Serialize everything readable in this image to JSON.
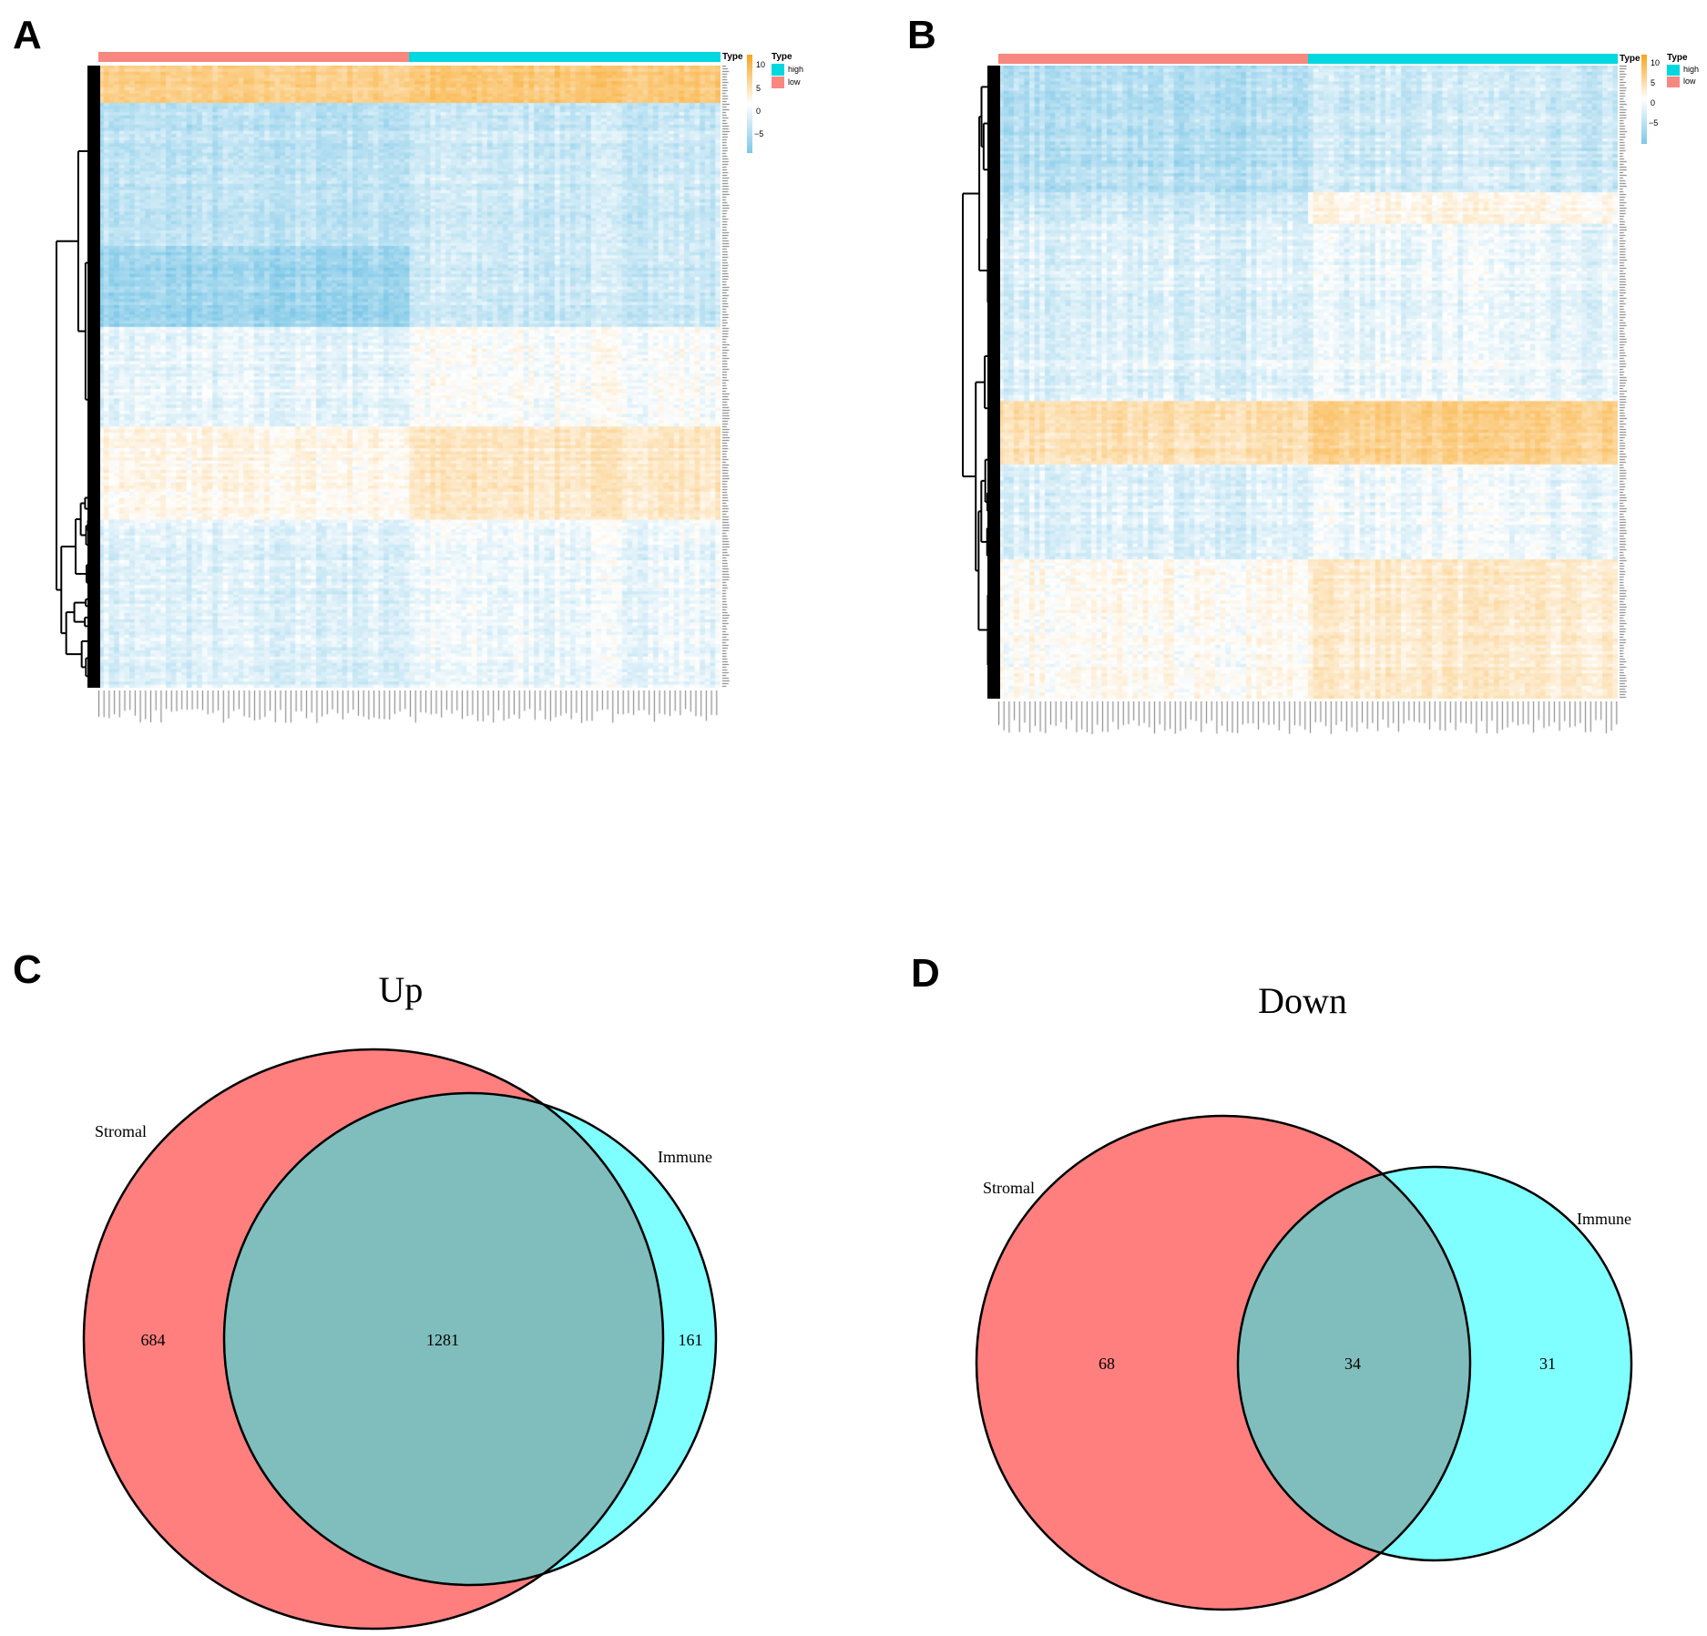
{
  "panels": {
    "a": "A",
    "b": "B",
    "c": "C",
    "d": "D"
  },
  "colors": {
    "low": "#F8877F",
    "high": "#00D7DF",
    "heat_high": "#F9A41C",
    "heat_mid": "#FFFFFF",
    "heat_low": "#7EC8E8",
    "venn_stromal": "#FF7F7F",
    "venn_immune": "#7FFFFF",
    "venn_overlap": "#80BDBD"
  },
  "chart_data": [
    {
      "type": "heatmap",
      "panel": "A",
      "annotation_label": "Type",
      "legend": {
        "title": "Type",
        "entries": [
          {
            "label": "high",
            "color": "#00D7DF"
          },
          {
            "label": "low",
            "color": "#F8877F"
          }
        ]
      },
      "colorbar": {
        "ticks": [
          "10",
          "5",
          "0",
          "−5"
        ],
        "range": [
          -8,
          12
        ]
      },
      "column_groups": [
        "low",
        "high"
      ],
      "row_dendrogram": true
    },
    {
      "type": "heatmap",
      "panel": "B",
      "annotation_label": "Type",
      "legend": {
        "title": "Type",
        "entries": [
          {
            "label": "high",
            "color": "#00D7DF"
          },
          {
            "label": "low",
            "color": "#F8877F"
          }
        ]
      },
      "colorbar": {
        "ticks": [
          "10",
          "5",
          "0",
          "−5"
        ],
        "range": [
          -8,
          12
        ]
      },
      "column_groups": [
        "low",
        "high"
      ],
      "row_dendrogram": true
    },
    {
      "type": "venn",
      "panel": "C",
      "title": "Up",
      "sets": [
        {
          "name": "Stromal",
          "only": 684
        },
        {
          "name": "Immune",
          "only": 161
        }
      ],
      "intersection": 1281
    },
    {
      "type": "venn",
      "panel": "D",
      "title": "Down",
      "sets": [
        {
          "name": "Stromal",
          "only": 68
        },
        {
          "name": "Immune",
          "only": 31
        }
      ],
      "intersection": 34
    }
  ]
}
